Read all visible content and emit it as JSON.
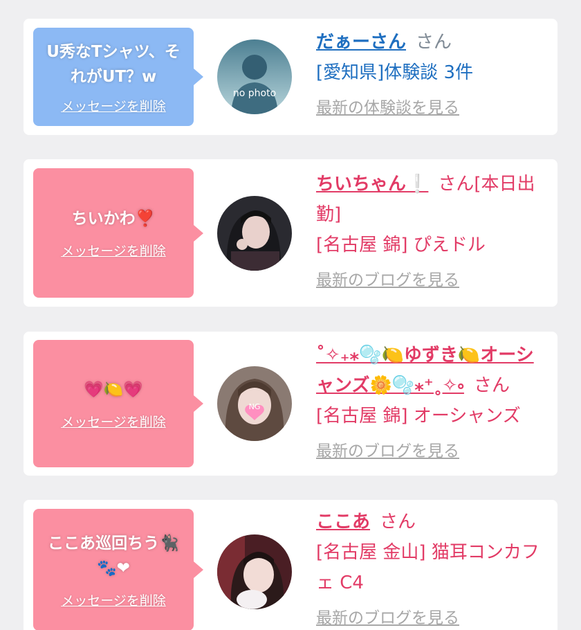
{
  "colors": {
    "blue_bubble": "#8cb9f4",
    "pink_bubble": "#fb8fa1",
    "blue_text": "#1f6fc0",
    "pink_text": "#e23b66",
    "link_gray": "#a7a7a7"
  },
  "cards": [
    {
      "bubble_text": "U秀なTシャツ、それがUT？w",
      "delete_label": "メッセージを削除",
      "avatar_label": "no photo",
      "name": "だぁーさん",
      "san": "さん",
      "info_line": "[愛知県]体験談 3件",
      "more_link": "最新の体験談を見る"
    },
    {
      "bubble_text": "ちいかわ❣️",
      "delete_label": "メッセージを削除",
      "name": "ちいちゃん❕",
      "san": "さん",
      "suffix": "[本日出勤]",
      "info_line": "[名古屋 錦] ぴえドル",
      "more_link": "最新のブログを見る"
    },
    {
      "bubble_text": "💗🍋💗",
      "delete_label": "メッセージを削除",
      "avatar_label": "NG",
      "name": "˚✧₊⁎🫧🍋ゆずき🍋オーシャンズ🌼🫧⁎⁺˳✧༚",
      "san": "さん",
      "info_line": "[名古屋 錦] オーシャンズ",
      "more_link": "最新のブログを見る"
    },
    {
      "bubble_text": "ここあ巡回ちう🐈‍⬛🐾❤",
      "delete_label": "メッセージを削除",
      "name": "ここあ",
      "san": "さん",
      "info_line": "[名古屋 金山] 猫耳コンカフェ C4",
      "more_link": "最新のブログを見る"
    }
  ]
}
